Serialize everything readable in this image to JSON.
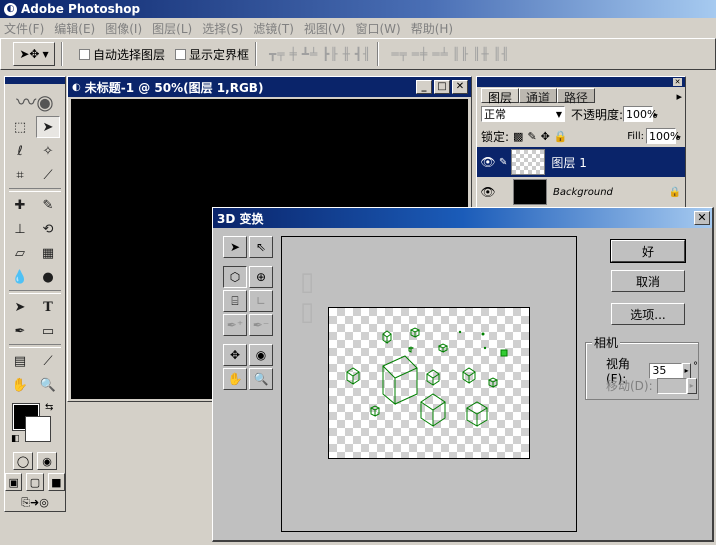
{
  "app": {
    "title": "Adobe Photoshop"
  },
  "menu": [
    "文件(F)",
    "编辑(E)",
    "图像(I)",
    "图层(L)",
    "选择(S)",
    "滤镜(T)",
    "视图(V)",
    "窗口(W)",
    "帮助(H)"
  ],
  "options": {
    "auto_select": "自动选择图层",
    "show_bounds": "显示定界框"
  },
  "document": {
    "title": "未标题-1 @ 50%(图层 1,RGB)"
  },
  "layers_palette": {
    "tabs": [
      "图层",
      "通道",
      "路径"
    ],
    "blend_mode": "正常",
    "opacity_label": "不透明度:",
    "opacity_value": "100%",
    "lock_label": "锁定:",
    "fill_label": "Fill:",
    "fill_value": "100%",
    "layers": [
      {
        "name": "图层 1",
        "selected": true
      },
      {
        "name": "Background",
        "selected": false
      }
    ]
  },
  "dialog": {
    "title": "3D 变换",
    "ok": "好",
    "cancel": "取消",
    "options": "选项...",
    "camera_legend": "相机",
    "fov_label": "视角(F):",
    "fov_value": "35",
    "dolly_label": "移动(D):",
    "degree_symbol": "°"
  },
  "colors": {
    "titlebar": "#0a246a",
    "cube_stroke": "#008000",
    "cube_highlight": "#33cc33"
  }
}
